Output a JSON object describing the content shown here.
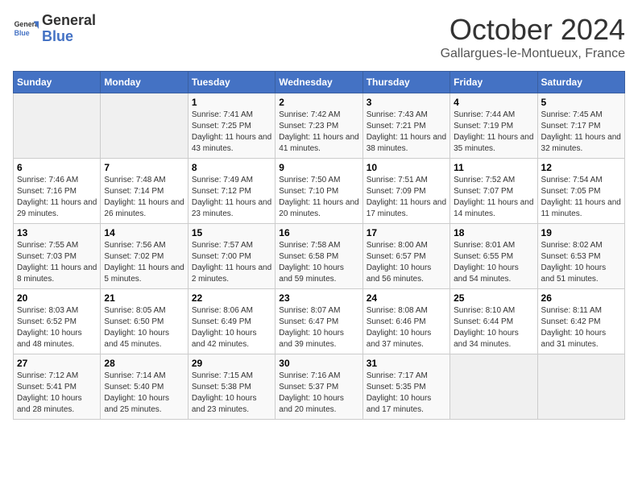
{
  "header": {
    "logo_line1": "General",
    "logo_line2": "Blue",
    "month": "October 2024",
    "location": "Gallargues-le-Montueux, France"
  },
  "days_of_week": [
    "Sunday",
    "Monday",
    "Tuesday",
    "Wednesday",
    "Thursday",
    "Friday",
    "Saturday"
  ],
  "weeks": [
    [
      {
        "day": "",
        "sunrise": "",
        "sunset": "",
        "daylight": ""
      },
      {
        "day": "",
        "sunrise": "",
        "sunset": "",
        "daylight": ""
      },
      {
        "day": "1",
        "sunrise": "Sunrise: 7:41 AM",
        "sunset": "Sunset: 7:25 PM",
        "daylight": "Daylight: 11 hours and 43 minutes."
      },
      {
        "day": "2",
        "sunrise": "Sunrise: 7:42 AM",
        "sunset": "Sunset: 7:23 PM",
        "daylight": "Daylight: 11 hours and 41 minutes."
      },
      {
        "day": "3",
        "sunrise": "Sunrise: 7:43 AM",
        "sunset": "Sunset: 7:21 PM",
        "daylight": "Daylight: 11 hours and 38 minutes."
      },
      {
        "day": "4",
        "sunrise": "Sunrise: 7:44 AM",
        "sunset": "Sunset: 7:19 PM",
        "daylight": "Daylight: 11 hours and 35 minutes."
      },
      {
        "day": "5",
        "sunrise": "Sunrise: 7:45 AM",
        "sunset": "Sunset: 7:17 PM",
        "daylight": "Daylight: 11 hours and 32 minutes."
      }
    ],
    [
      {
        "day": "6",
        "sunrise": "Sunrise: 7:46 AM",
        "sunset": "Sunset: 7:16 PM",
        "daylight": "Daylight: 11 hours and 29 minutes."
      },
      {
        "day": "7",
        "sunrise": "Sunrise: 7:48 AM",
        "sunset": "Sunset: 7:14 PM",
        "daylight": "Daylight: 11 hours and 26 minutes."
      },
      {
        "day": "8",
        "sunrise": "Sunrise: 7:49 AM",
        "sunset": "Sunset: 7:12 PM",
        "daylight": "Daylight: 11 hours and 23 minutes."
      },
      {
        "day": "9",
        "sunrise": "Sunrise: 7:50 AM",
        "sunset": "Sunset: 7:10 PM",
        "daylight": "Daylight: 11 hours and 20 minutes."
      },
      {
        "day": "10",
        "sunrise": "Sunrise: 7:51 AM",
        "sunset": "Sunset: 7:09 PM",
        "daylight": "Daylight: 11 hours and 17 minutes."
      },
      {
        "day": "11",
        "sunrise": "Sunrise: 7:52 AM",
        "sunset": "Sunset: 7:07 PM",
        "daylight": "Daylight: 11 hours and 14 minutes."
      },
      {
        "day": "12",
        "sunrise": "Sunrise: 7:54 AM",
        "sunset": "Sunset: 7:05 PM",
        "daylight": "Daylight: 11 hours and 11 minutes."
      }
    ],
    [
      {
        "day": "13",
        "sunrise": "Sunrise: 7:55 AM",
        "sunset": "Sunset: 7:03 PM",
        "daylight": "Daylight: 11 hours and 8 minutes."
      },
      {
        "day": "14",
        "sunrise": "Sunrise: 7:56 AM",
        "sunset": "Sunset: 7:02 PM",
        "daylight": "Daylight: 11 hours and 5 minutes."
      },
      {
        "day": "15",
        "sunrise": "Sunrise: 7:57 AM",
        "sunset": "Sunset: 7:00 PM",
        "daylight": "Daylight: 11 hours and 2 minutes."
      },
      {
        "day": "16",
        "sunrise": "Sunrise: 7:58 AM",
        "sunset": "Sunset: 6:58 PM",
        "daylight": "Daylight: 10 hours and 59 minutes."
      },
      {
        "day": "17",
        "sunrise": "Sunrise: 8:00 AM",
        "sunset": "Sunset: 6:57 PM",
        "daylight": "Daylight: 10 hours and 56 minutes."
      },
      {
        "day": "18",
        "sunrise": "Sunrise: 8:01 AM",
        "sunset": "Sunset: 6:55 PM",
        "daylight": "Daylight: 10 hours and 54 minutes."
      },
      {
        "day": "19",
        "sunrise": "Sunrise: 8:02 AM",
        "sunset": "Sunset: 6:53 PM",
        "daylight": "Daylight: 10 hours and 51 minutes."
      }
    ],
    [
      {
        "day": "20",
        "sunrise": "Sunrise: 8:03 AM",
        "sunset": "Sunset: 6:52 PM",
        "daylight": "Daylight: 10 hours and 48 minutes."
      },
      {
        "day": "21",
        "sunrise": "Sunrise: 8:05 AM",
        "sunset": "Sunset: 6:50 PM",
        "daylight": "Daylight: 10 hours and 45 minutes."
      },
      {
        "day": "22",
        "sunrise": "Sunrise: 8:06 AM",
        "sunset": "Sunset: 6:49 PM",
        "daylight": "Daylight: 10 hours and 42 minutes."
      },
      {
        "day": "23",
        "sunrise": "Sunrise: 8:07 AM",
        "sunset": "Sunset: 6:47 PM",
        "daylight": "Daylight: 10 hours and 39 minutes."
      },
      {
        "day": "24",
        "sunrise": "Sunrise: 8:08 AM",
        "sunset": "Sunset: 6:46 PM",
        "daylight": "Daylight: 10 hours and 37 minutes."
      },
      {
        "day": "25",
        "sunrise": "Sunrise: 8:10 AM",
        "sunset": "Sunset: 6:44 PM",
        "daylight": "Daylight: 10 hours and 34 minutes."
      },
      {
        "day": "26",
        "sunrise": "Sunrise: 8:11 AM",
        "sunset": "Sunset: 6:42 PM",
        "daylight": "Daylight: 10 hours and 31 minutes."
      }
    ],
    [
      {
        "day": "27",
        "sunrise": "Sunrise: 7:12 AM",
        "sunset": "Sunset: 5:41 PM",
        "daylight": "Daylight: 10 hours and 28 minutes."
      },
      {
        "day": "28",
        "sunrise": "Sunrise: 7:14 AM",
        "sunset": "Sunset: 5:40 PM",
        "daylight": "Daylight: 10 hours and 25 minutes."
      },
      {
        "day": "29",
        "sunrise": "Sunrise: 7:15 AM",
        "sunset": "Sunset: 5:38 PM",
        "daylight": "Daylight: 10 hours and 23 minutes."
      },
      {
        "day": "30",
        "sunrise": "Sunrise: 7:16 AM",
        "sunset": "Sunset: 5:37 PM",
        "daylight": "Daylight: 10 hours and 20 minutes."
      },
      {
        "day": "31",
        "sunrise": "Sunrise: 7:17 AM",
        "sunset": "Sunset: 5:35 PM",
        "daylight": "Daylight: 10 hours and 17 minutes."
      },
      {
        "day": "",
        "sunrise": "",
        "sunset": "",
        "daylight": ""
      },
      {
        "day": "",
        "sunrise": "",
        "sunset": "",
        "daylight": ""
      }
    ]
  ]
}
